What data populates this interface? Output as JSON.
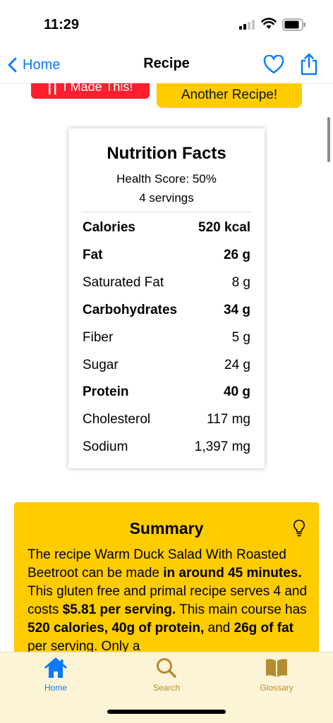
{
  "status": {
    "time": "11:29"
  },
  "nav": {
    "back_label": "Home",
    "title": "Recipe"
  },
  "actions": {
    "made_this_label": "I Made This!",
    "another_recipe_label": "Another Recipe!"
  },
  "nutrition": {
    "title": "Nutrition Facts",
    "health_score": "Health Score: 50%",
    "servings": "4 servings",
    "rows": [
      {
        "label": "Calories",
        "value": "520 kcal",
        "bold": true
      },
      {
        "label": "Fat",
        "value": "26 g",
        "bold": true
      },
      {
        "label": "Saturated Fat",
        "value": "8 g",
        "bold": false
      },
      {
        "label": "Carbohydrates",
        "value": "34 g",
        "bold": true
      },
      {
        "label": "Fiber",
        "value": "5 g",
        "bold": false
      },
      {
        "label": "Sugar",
        "value": "24 g",
        "bold": false
      },
      {
        "label": "Protein",
        "value": "40 g",
        "bold": true
      },
      {
        "label": "Cholesterol",
        "value": "117 mg",
        "bold": false
      },
      {
        "label": "Sodium",
        "value": "1,397 mg",
        "bold": false
      }
    ]
  },
  "summary": {
    "title": "Summary",
    "text_1": "The recipe Warm Duck Salad With Roasted Beetroot can be made ",
    "text_2": "in around 45 minutes.",
    "text_3": " This gluten free and primal recipe serves 4 and costs ",
    "text_4": "$5.81 per serving.",
    "text_5": " This main course has ",
    "text_6": "520 calories, 40g of protein,",
    "text_7": " and ",
    "text_8": "26g of fat",
    "text_9": " per serving. Only a"
  },
  "tabs": [
    {
      "label": "Home",
      "icon": "house-icon",
      "active": true
    },
    {
      "label": "Search",
      "icon": "magnifier-icon",
      "active": false
    },
    {
      "label": "Glossary",
      "icon": "book-icon",
      "active": false
    }
  ],
  "colors": {
    "accent_blue": "#0a7aff",
    "made_red": "#ff1e2d",
    "yellow": "#ffcc00",
    "tab_bar_bg": "#fcf4d6",
    "tab_inactive": "#b58b30"
  }
}
